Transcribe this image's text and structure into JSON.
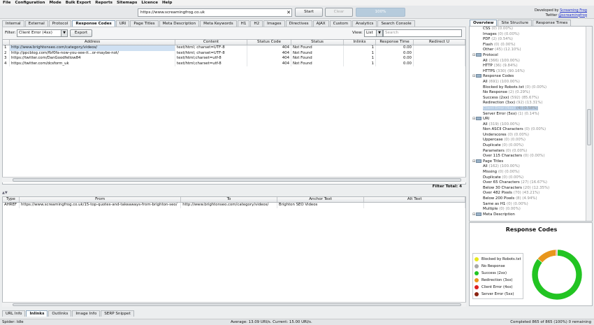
{
  "menu": [
    "File",
    "Configuration",
    "Mode",
    "Bulk Export",
    "Reports",
    "Sitemaps",
    "Licence",
    "Help"
  ],
  "toolbar": {
    "url": "https://www.screamingfrog.co.uk",
    "clear_icon": "✕",
    "start": "Start",
    "clear": "Clear",
    "progress": "100%",
    "progress_value": 100,
    "developed_by": "Developed by",
    "developer": "Screaming Frog",
    "twitter": "Twitter",
    "twitter_handle": "@screamingfrog"
  },
  "top_tabs": [
    "Internal",
    "External",
    "Protocol",
    "Response Codes",
    "URI",
    "Page Titles",
    "Meta Description",
    "Meta Keywords",
    "H1",
    "H2",
    "Images",
    "Directives",
    "AJAX",
    "Custom",
    "Analytics",
    "Search Console"
  ],
  "active_top_tab": "Response Codes",
  "filter": {
    "label": "Filter:",
    "value": "Client Error (4xx)",
    "export": "Export",
    "view_label": "View:",
    "view_value": "List",
    "search_placeholder": "Search"
  },
  "main_table": {
    "columns": [
      "",
      "Address",
      "Content",
      "Status Code",
      "Status",
      "Inlinks",
      "Response Time",
      "Redirect U"
    ],
    "rows": [
      {
        "n": "1",
        "address": "http://www.brightonseo.com/category/videos/",
        "content": "text/html; charset=UTF-8",
        "code": "404",
        "status": "Not Found",
        "inlinks": "1",
        "time": "0.00",
        "redirect": ""
      },
      {
        "n": "2",
        "address": "http://ppcblog.com/fbf0fa-now-you-see-it...or-maybe-not/",
        "content": "text/html; charset=UTF-8",
        "code": "404",
        "status": "Not Found",
        "inlinks": "1",
        "time": "0.00",
        "redirect": ""
      },
      {
        "n": "3",
        "address": "https://twitter.com/DanGoodfellow84",
        "content": "text/html;charset=utf-8",
        "code": "404",
        "status": "Not Found",
        "inlinks": "1",
        "time": "0.00",
        "redirect": ""
      },
      {
        "n": "4",
        "address": "https://twitter.com/dcsform_uk",
        "content": "text/html;charset=utf-8",
        "code": "404",
        "status": "Not Found",
        "inlinks": "1",
        "time": "0.00",
        "redirect": ""
      }
    ],
    "filter_total_label": "Filter Total:",
    "filter_total": "4"
  },
  "lower_table": {
    "columns": [
      "Type",
      "From",
      "To",
      "Anchor Text",
      "Alt Text"
    ],
    "rows": [
      {
        "type": "AHREF",
        "from": "https://www.screamingfrog.co.uk/15-top-quotes-and-takeaways-from-brighton-seo/",
        "to": "http://www.brightonseo.com/category/videos/",
        "anchor": "Brighton SEO Videos",
        "alt": ""
      }
    ]
  },
  "bottom_tabs": [
    "URL Info",
    "Inlinks",
    "Outlinks",
    "Image Info",
    "SERP Snippet"
  ],
  "active_bottom_tab": "Inlinks",
  "status": {
    "left": "Spider: Idle",
    "center": "Average: 13.09 URI/s. Current: 15.00 URI/s.",
    "right": "Completed 865 of 865 (100%) 0 remaining"
  },
  "right_tabs": [
    "Overview",
    "Site Structure",
    "Response Times"
  ],
  "active_right_tab": "Overview",
  "tree": [
    {
      "level": 2,
      "label": "CSS",
      "count": "(0) (0.00%)"
    },
    {
      "level": 2,
      "label": "Images",
      "count": "(0) (0.00%)"
    },
    {
      "level": 2,
      "label": "PDF",
      "count": "(2) (0.54%)"
    },
    {
      "level": 2,
      "label": "Flash",
      "count": "(0) (0.00%)"
    },
    {
      "level": 2,
      "label": "Other",
      "count": "(45) (12.10%)"
    },
    {
      "level": 1,
      "label": "Protocol",
      "count": "",
      "group": true
    },
    {
      "level": 2,
      "label": "All",
      "count": "(366) (100.00%)"
    },
    {
      "level": 2,
      "label": "HTTP",
      "count": "(36) (9.84%)"
    },
    {
      "level": 2,
      "label": "HTTPS",
      "count": "(330) (90.16%)"
    },
    {
      "level": 1,
      "label": "Response Codes",
      "count": "",
      "group": true
    },
    {
      "level": 2,
      "label": "All",
      "count": "(691) (100.00%)"
    },
    {
      "level": 2,
      "label": "Blocked by Robots.txt",
      "count": "(0) (0.00%)"
    },
    {
      "level": 2,
      "label": "No Response",
      "count": "(2) (0.29%)"
    },
    {
      "level": 2,
      "label": "Success (2xx)",
      "count": "(592) (85.67%)"
    },
    {
      "level": 2,
      "label": "Redirection (3xx)",
      "count": "(92) (13.31%)"
    },
    {
      "level": 2,
      "label": "Client Error (4xx)",
      "count": "(4) (0.58%)",
      "selected": true
    },
    {
      "level": 2,
      "label": "Server Error (5xx)",
      "count": "(1) (0.14%)"
    },
    {
      "level": 1,
      "label": "URI",
      "count": "",
      "group": true
    },
    {
      "level": 2,
      "label": "All",
      "count": "(319) (100.00%)"
    },
    {
      "level": 2,
      "label": "Non ASCII Characters",
      "count": "(0) (0.00%)"
    },
    {
      "level": 2,
      "label": "Underscores",
      "count": "(0) (0.00%)"
    },
    {
      "level": 2,
      "label": "Uppercase",
      "count": "(0) (0.00%)"
    },
    {
      "level": 2,
      "label": "Duplicate",
      "count": "(0) (0.00%)"
    },
    {
      "level": 2,
      "label": "Parameters",
      "count": "(0) (0.00%)"
    },
    {
      "level": 2,
      "label": "Over 115 Characters",
      "count": "(0) (0.00%)"
    },
    {
      "level": 1,
      "label": "Page Titles",
      "count": "",
      "group": true
    },
    {
      "level": 2,
      "label": "All",
      "count": "(162) (100.00%)"
    },
    {
      "level": 2,
      "label": "Missing",
      "count": "(0) (0.00%)"
    },
    {
      "level": 2,
      "label": "Duplicate",
      "count": "(0) (0.00%)"
    },
    {
      "level": 2,
      "label": "Over 65 Characters",
      "count": "(27) (16.67%)"
    },
    {
      "level": 2,
      "label": "Below 30 Characters",
      "count": "(20) (12.35%)"
    },
    {
      "level": 2,
      "label": "Over 482 Pixels",
      "count": "(70) (43.21%)"
    },
    {
      "level": 2,
      "label": "Below 200 Pixels",
      "count": "(8) (4.94%)"
    },
    {
      "level": 2,
      "label": "Same as H1",
      "count": "(0) (0.00%)"
    },
    {
      "level": 2,
      "label": "Multiple",
      "count": "(0) (0.00%)"
    },
    {
      "level": 1,
      "label": "Meta Description",
      "count": "",
      "group": true
    }
  ],
  "chart_data": {
    "type": "pie",
    "title": "Response Codes",
    "categories": [
      "Blocked by Robots.txt",
      "No Response",
      "Success (2xx)",
      "Redirection (3xx)",
      "Client Error (4xx)",
      "Server Error (5xx)"
    ],
    "values": [
      0,
      2,
      592,
      92,
      4,
      1
    ],
    "colors": [
      "#e8e81c",
      "#a8a8a8",
      "#22c422",
      "#e8961c",
      "#dd1e1e",
      "#8a2412"
    ],
    "legend_position": "left"
  }
}
